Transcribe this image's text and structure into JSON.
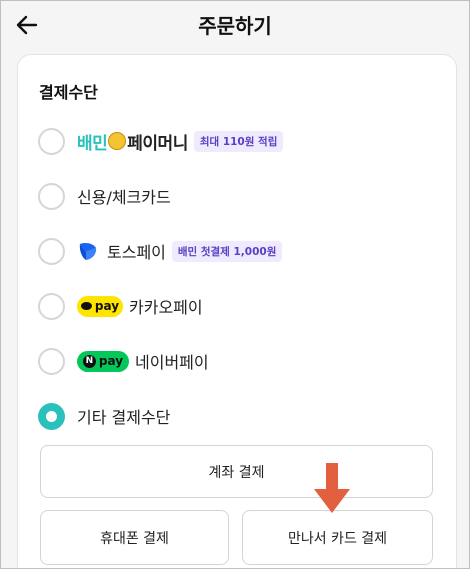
{
  "header": {
    "title": "주문하기",
    "back_icon": "arrow-left-icon"
  },
  "payment": {
    "section_title": "결제수단",
    "options": [
      {
        "id": "baemin-paymoney",
        "brand_part1": "배민",
        "brand_part2": "페이머니",
        "badge": "최대 110원 적립",
        "selected": false
      },
      {
        "id": "credit-card",
        "label": "신용/체크카드",
        "selected": false
      },
      {
        "id": "toss-pay",
        "label": "토스페이",
        "badge": "배민 첫결제 1,000원",
        "icon": "toss-icon",
        "selected": false
      },
      {
        "id": "kakao-pay",
        "label": "카카오페이",
        "logo_text": "pay",
        "selected": false
      },
      {
        "id": "naver-pay",
        "label": "네이버페이",
        "logo_letter": "N",
        "logo_text": "pay",
        "selected": false
      },
      {
        "id": "other",
        "label": "기타 결제수단",
        "selected": true
      }
    ],
    "sub_buttons": {
      "bank_transfer": "계좌 결제",
      "phone": "휴대폰 결제",
      "meet_card": "만나서 카드 결제"
    }
  },
  "colors": {
    "accent": "#2ac1bc",
    "arrow": "#e2603f",
    "badge_text": "#5b3fc4",
    "badge_bg": "#efeafd",
    "kakao": "#fee500",
    "naver": "#03c75a",
    "toss": "#1b64f2"
  }
}
